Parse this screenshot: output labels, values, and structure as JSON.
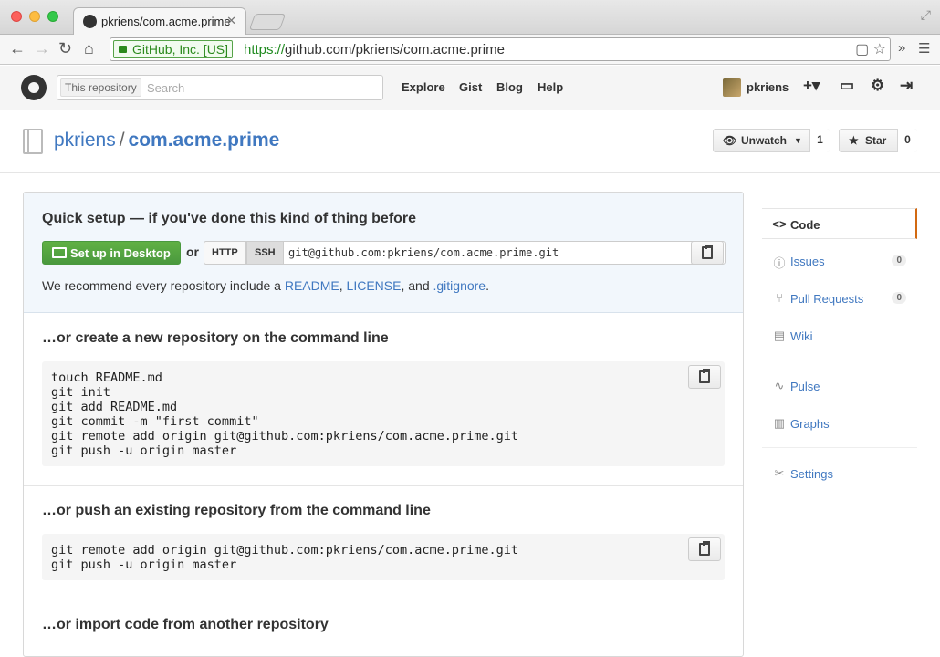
{
  "browser": {
    "tab_title": "pkriens/com.acme.prime",
    "tab_close": "✕",
    "ev_label": "GitHub, Inc. [US]",
    "url_scheme": "https://",
    "url_host": "github.com",
    "url_path": "/pkriens/com.acme.prime",
    "overflow": "»"
  },
  "header": {
    "search_scope": "This repository",
    "search_placeholder": "Search",
    "nav": [
      "Explore",
      "Gist",
      "Blog",
      "Help"
    ],
    "username": "pkriens"
  },
  "repo": {
    "owner": "pkriens",
    "name": "com.acme.prime",
    "watch_label": "Unwatch",
    "watch_count": "1",
    "star_label": "Star",
    "star_count": "0"
  },
  "quick_setup": {
    "title": "Quick setup — if you've done this kind of thing before",
    "desktop_button": "Set up in Desktop",
    "or": "or",
    "http": "HTTP",
    "ssh": "SSH",
    "clone_url": "git@github.com:pkriens/com.acme.prime.git",
    "recommend_pre": "We recommend every repository include a ",
    "readme": "README",
    "comma": ", ",
    "license": "LICENSE",
    "and": ", and ",
    "gitignore": ".gitignore",
    "period": "."
  },
  "sections": {
    "new_repo_title": "…or create a new repository on the command line",
    "new_repo_code": "touch README.md\ngit init\ngit add README.md\ngit commit -m \"first commit\"\ngit remote add origin git@github.com:pkriens/com.acme.prime.git\ngit push -u origin master",
    "push_title": "…or push an existing repository from the command line",
    "push_code": "git remote add origin git@github.com:pkriens/com.acme.prime.git\ngit push -u origin master",
    "import_title": "…or import code from another repository"
  },
  "sidebar": {
    "items": [
      {
        "label": "Code",
        "icon": "code-icon"
      },
      {
        "label": "Issues",
        "icon": "issue-icon",
        "count": "0"
      },
      {
        "label": "Pull Requests",
        "icon": "pull-request-icon",
        "count": "0"
      },
      {
        "label": "Wiki",
        "icon": "book-icon"
      },
      {
        "label": "Pulse",
        "icon": "pulse-icon"
      },
      {
        "label": "Graphs",
        "icon": "graph-icon"
      },
      {
        "label": "Settings",
        "icon": "tools-icon"
      }
    ]
  }
}
